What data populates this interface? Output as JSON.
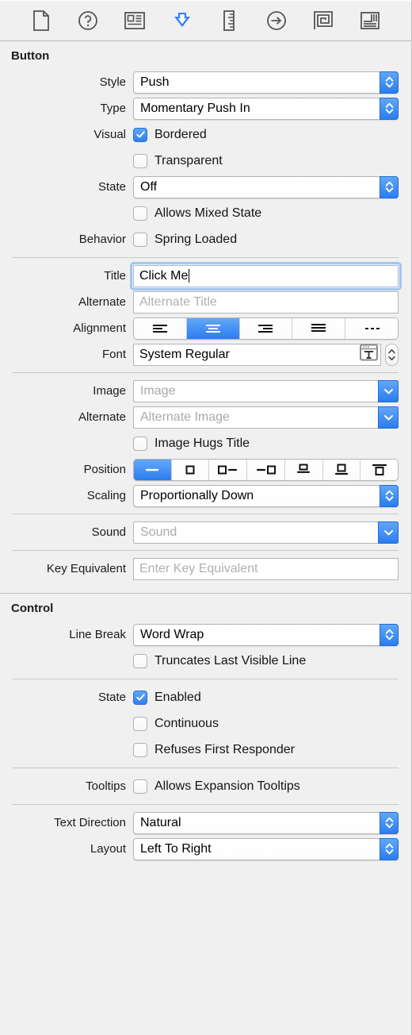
{
  "toolbar": {
    "items": [
      {
        "icon": "file-inspector-icon",
        "name": "tab-file-inspector",
        "selected": false
      },
      {
        "icon": "quick-help-inspector-icon",
        "name": "tab-quick-help-inspector",
        "selected": false
      },
      {
        "icon": "identity-inspector-icon",
        "name": "tab-identity-inspector",
        "selected": false
      },
      {
        "icon": "attributes-inspector-icon",
        "name": "tab-attributes-inspector",
        "selected": true
      },
      {
        "icon": "size-inspector-icon",
        "name": "tab-size-inspector",
        "selected": false
      },
      {
        "icon": "connections-inspector-icon",
        "name": "tab-connections-inspector",
        "selected": false
      },
      {
        "icon": "bindings-inspector-icon",
        "name": "tab-bindings-inspector",
        "selected": false
      },
      {
        "icon": "view-effects-inspector-icon",
        "name": "tab-view-effects-inspector",
        "selected": false
      }
    ],
    "selected_color": "#3580f2",
    "icon_color": "#545454"
  },
  "button_section": {
    "title": "Button",
    "style": {
      "label": "Style",
      "value": "Push"
    },
    "type": {
      "label": "Type",
      "value": "Momentary Push In"
    },
    "visual": {
      "label": "Visual",
      "bordered": {
        "label": "Bordered",
        "checked": true
      },
      "transparent": {
        "label": "Transparent",
        "checked": false
      }
    },
    "state": {
      "label": "State",
      "value": "Off",
      "allows_mixed": {
        "label": "Allows Mixed State",
        "checked": false
      }
    },
    "behavior": {
      "label": "Behavior",
      "spring_loaded": {
        "label": "Spring Loaded",
        "checked": false
      }
    },
    "title_field": {
      "label": "Title",
      "value": "Click Me",
      "focused": true
    },
    "alternate_title": {
      "label": "Alternate",
      "placeholder": "Alternate Title"
    },
    "alignment": {
      "label": "Alignment",
      "options": [
        "align-left",
        "align-center",
        "align-right",
        "align-justified",
        "align-natural"
      ],
      "selected_index": 1
    },
    "font": {
      "label": "Font",
      "value": "System Regular"
    },
    "image": {
      "label": "Image",
      "placeholder": "Image"
    },
    "alternate_image": {
      "label": "Alternate",
      "placeholder": "Alternate Image"
    },
    "image_hugs_title": {
      "label": "Image Hugs Title",
      "checked": false
    },
    "position": {
      "label": "Position",
      "options": [
        "title-only",
        "image-only",
        "image-left",
        "image-right",
        "image-above",
        "image-below",
        "image-overlaps"
      ],
      "selected_index": 0
    },
    "scaling": {
      "label": "Scaling",
      "value": "Proportionally Down"
    },
    "sound": {
      "label": "Sound",
      "placeholder": "Sound"
    },
    "key_equivalent": {
      "label": "Key Equivalent",
      "placeholder": "Enter Key Equivalent"
    }
  },
  "control_section": {
    "title": "Control",
    "line_break": {
      "label": "Line Break",
      "value": "Word Wrap"
    },
    "truncates": {
      "label": "Truncates Last Visible Line",
      "checked": false
    },
    "state": {
      "label": "State",
      "enabled": {
        "label": "Enabled",
        "checked": true
      },
      "continuous": {
        "label": "Continuous",
        "checked": false
      },
      "refuses_first_responder": {
        "label": "Refuses First Responder",
        "checked": false
      }
    },
    "tooltips": {
      "label": "Tooltips",
      "allows_expansion": {
        "label": "Allows Expansion Tooltips",
        "checked": false
      }
    },
    "text_direction": {
      "label": "Text Direction",
      "value": "Natural"
    },
    "layout": {
      "label": "Layout",
      "value": "Left To Right"
    }
  }
}
